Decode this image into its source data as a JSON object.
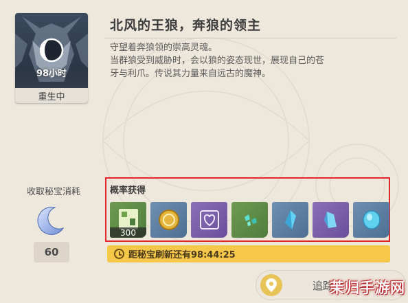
{
  "boss": {
    "name": "北风的王狼，奔狼的领主",
    "timer": "98小时",
    "status": "重生中",
    "description_lines": [
      "守望着奔狼领的崇高灵魂。",
      "当群狼受到威胁时，会以狼的姿态现世，展现自己的苍",
      "牙与利爪。传说其力量来自远古的魔神。"
    ]
  },
  "cost": {
    "label": "收取秘宝消耗",
    "icon": "crescent-moon-resin-icon",
    "value": "60"
  },
  "rewards": {
    "title": "概率获得",
    "items": [
      {
        "name": "adventure-exp-icon",
        "count": "300",
        "color": "#5f8c47"
      },
      {
        "name": "mora-coin-icon",
        "count": "",
        "color": "#5f80a2"
      },
      {
        "name": "companionship-exp-icon",
        "count": "",
        "color": "#7a5fa9"
      },
      {
        "name": "anemo-gem-fragment-icon",
        "count": "",
        "color": "#5f8c47"
      },
      {
        "name": "blue-crystal-fragment-icon",
        "count": "",
        "color": "#5f80a2"
      },
      {
        "name": "purple-crystal-chunk-icon",
        "count": "",
        "color": "#7a5fa9"
      },
      {
        "name": "blue-gem-icon",
        "count": "",
        "color": "#5f80a2"
      }
    ]
  },
  "refresh": {
    "text": "距秘宝刷新还有98:44:25"
  },
  "track_button": {
    "label": "追踪",
    "icon": "location-pin-icon"
  },
  "watermark": "茉归手游网",
  "colors": {
    "highlight_border": "#e3262a",
    "refresh_bar": "#f5c84a",
    "background": "#ede7dc"
  }
}
